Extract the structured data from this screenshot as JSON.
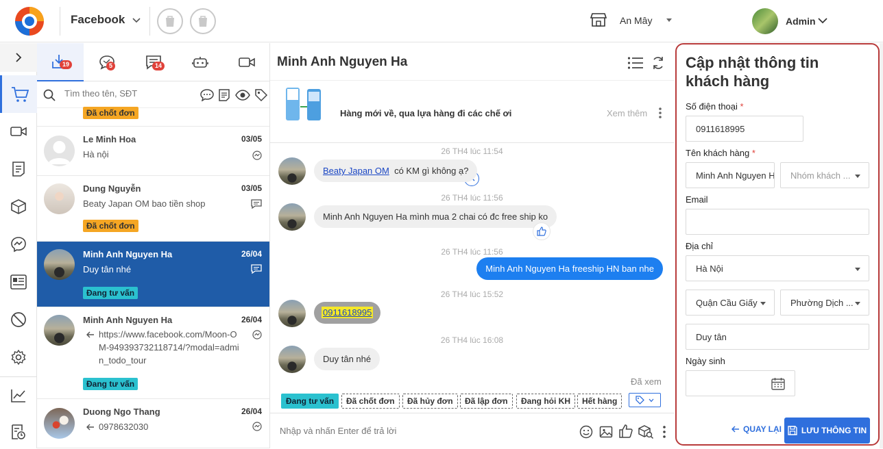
{
  "header": {
    "channel": "Facebook",
    "store_name": "An Mây",
    "user_name": "Admin"
  },
  "tabs": [
    {
      "icon": "inbox-download-icon",
      "badge": "19"
    },
    {
      "icon": "comment-icon",
      "badge": "5"
    },
    {
      "icon": "message-icon",
      "badge": "14"
    },
    {
      "icon": "bot-icon",
      "badge": ""
    },
    {
      "icon": "video-icon",
      "badge": ""
    }
  ],
  "search": {
    "placeholder": "Tìm theo tên, SĐT"
  },
  "conversations": [
    {
      "name": "",
      "date": "",
      "preview": "",
      "tag": "Đã chốt đơn"
    },
    {
      "name": "Le Minh Hoa",
      "date": "03/05",
      "preview": "Hà nội",
      "tag": ""
    },
    {
      "name": "Dung Nguyễn",
      "date": "03/05",
      "preview": "Beaty Japan OM bao tiền shop",
      "tag": "Đã chốt đơn"
    },
    {
      "name": "Minh Anh Nguyen Ha",
      "date": "26/04",
      "preview": "Duy tân nhé",
      "tag": "Đang tư vấn"
    },
    {
      "name": "Minh Anh Nguyen Ha",
      "date": "26/04",
      "preview": "https://www.facebook.com/Moon-OM-949393732118714/?modal=admin_todo_tour",
      "tag": "Đang tư vấn"
    },
    {
      "name": "Duong Ngo Thang",
      "date": "26/04",
      "preview": "0978632030",
      "tag": ""
    }
  ],
  "chat": {
    "title": "Minh Anh Nguyen Ha",
    "post_text": "Hàng mới về, qua lựa hàng đi các chế ơi",
    "post_more": "Xem thêm",
    "messages": [
      {
        "time": "26 TH4 lúc 11:54",
        "link": "Beaty Japan OM",
        "text": "có KM gì không ạ?"
      },
      {
        "time": "26 TH4 lúc 11:56",
        "text": "Minh Anh Nguyen Ha mình mua 2 chai có đc free ship ko"
      },
      {
        "time": "26 TH4 lúc 11:56",
        "text": "Minh Anh Nguyen Ha freeship HN ban nhe"
      },
      {
        "time": "26 TH4 lúc 15:52",
        "text": "0911618995"
      },
      {
        "time": "26 TH4 lúc 16:08",
        "text": "Duy tân nhé"
      }
    ],
    "seen": "Đã xem",
    "quick_tags": [
      "Đang tư vấn",
      "Đã chốt đơn",
      "Đã hủy đơn",
      "Đã lập đơn",
      "Đang hỏi KH",
      "Hết hàng"
    ],
    "composer_placeholder": "Nhập và nhấn Enter để trả lời"
  },
  "form": {
    "title": "Cập nhật thông tin khách hàng",
    "phone_label": "Số điện thoại",
    "phone_value": "0911618995",
    "name_label": "Tên khách hàng",
    "name_value": "Minh Anh Nguyen Ha",
    "group_placeholder": "Nhóm khách ...",
    "email_label": "Email",
    "email_value": "",
    "address_label": "Địa chỉ",
    "city": "Hà Nội",
    "district": "Quận Cầu Giấy",
    "ward": "Phường Dịch ...",
    "street": "Duy tân",
    "birthday_label": "Ngày sinh",
    "birthday_value": "",
    "back_label": "QUAY LẠI",
    "save_label": "LƯU THÔNG TIN"
  }
}
